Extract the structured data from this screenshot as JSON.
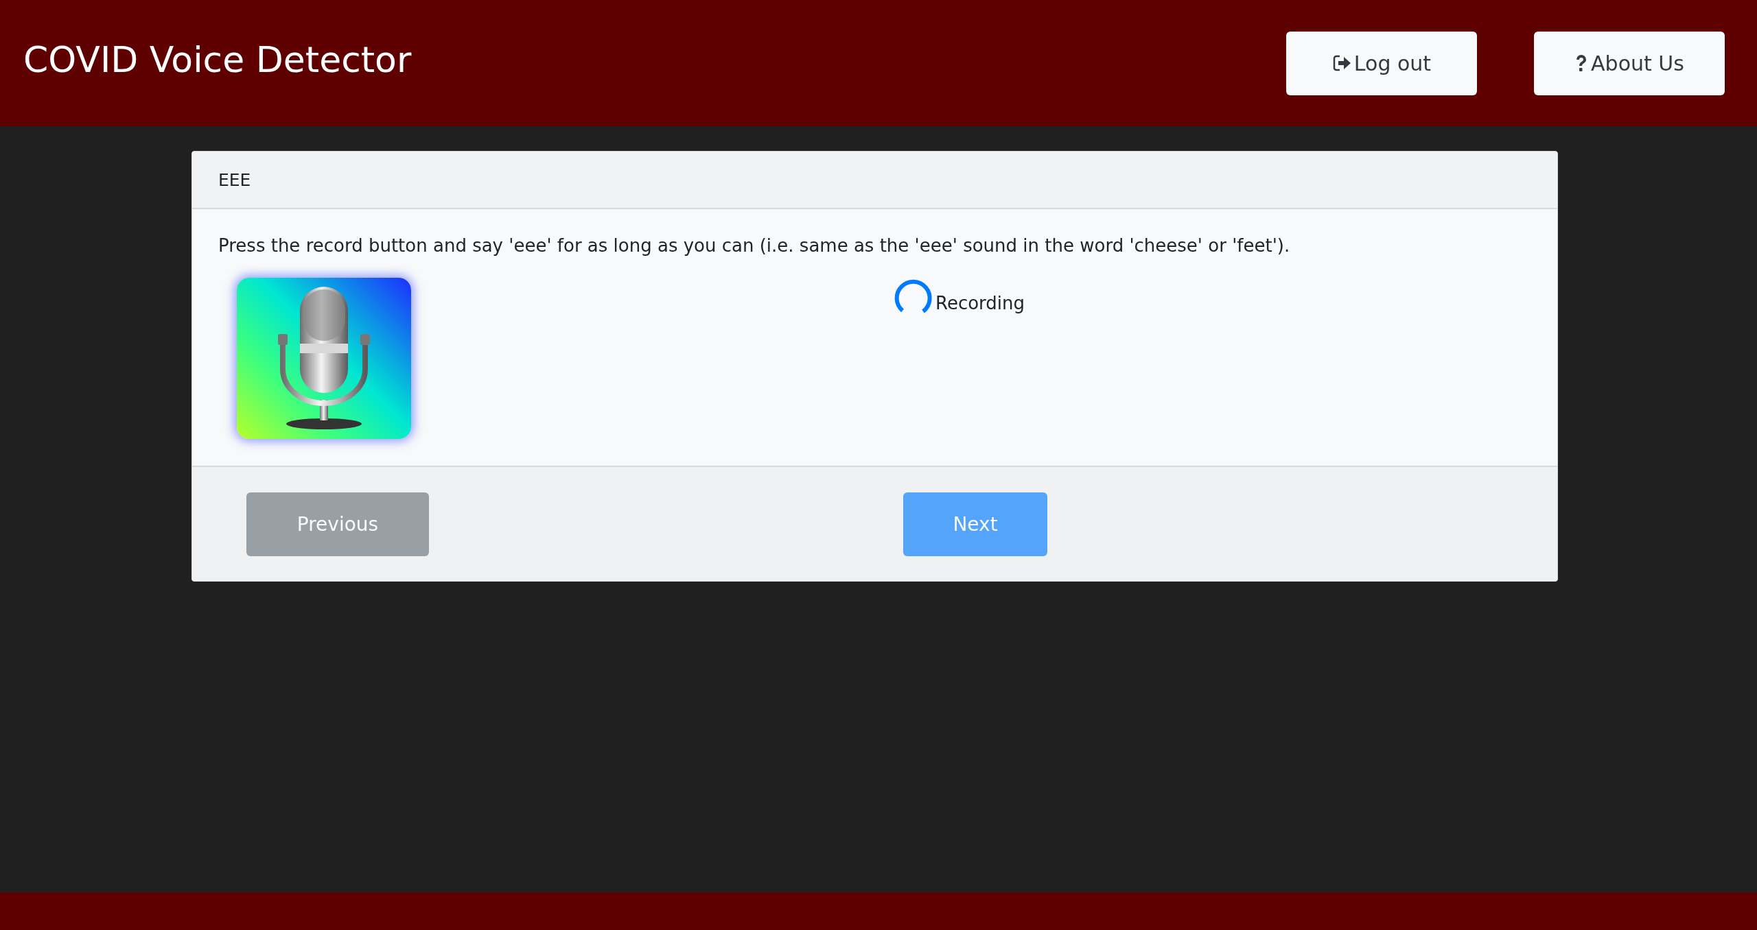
{
  "header": {
    "title": "COVID Voice Detector",
    "buttons": [
      {
        "kind": "logout",
        "label": "Log out"
      },
      {
        "kind": "help",
        "label": "About Us"
      }
    ]
  },
  "card": {
    "title": "EEE",
    "instruction": "Press the record button and say 'eee' for as long as you can (i.e. same as the 'eee' sound in the word 'cheese' or 'feet').",
    "status": {
      "recording": true,
      "label": "Recording"
    },
    "buttons": [
      {
        "kind": "secondary",
        "label": "Previous",
        "disabled": true
      },
      {
        "kind": "primary",
        "label": "Next",
        "disabled": true
      }
    ]
  }
}
